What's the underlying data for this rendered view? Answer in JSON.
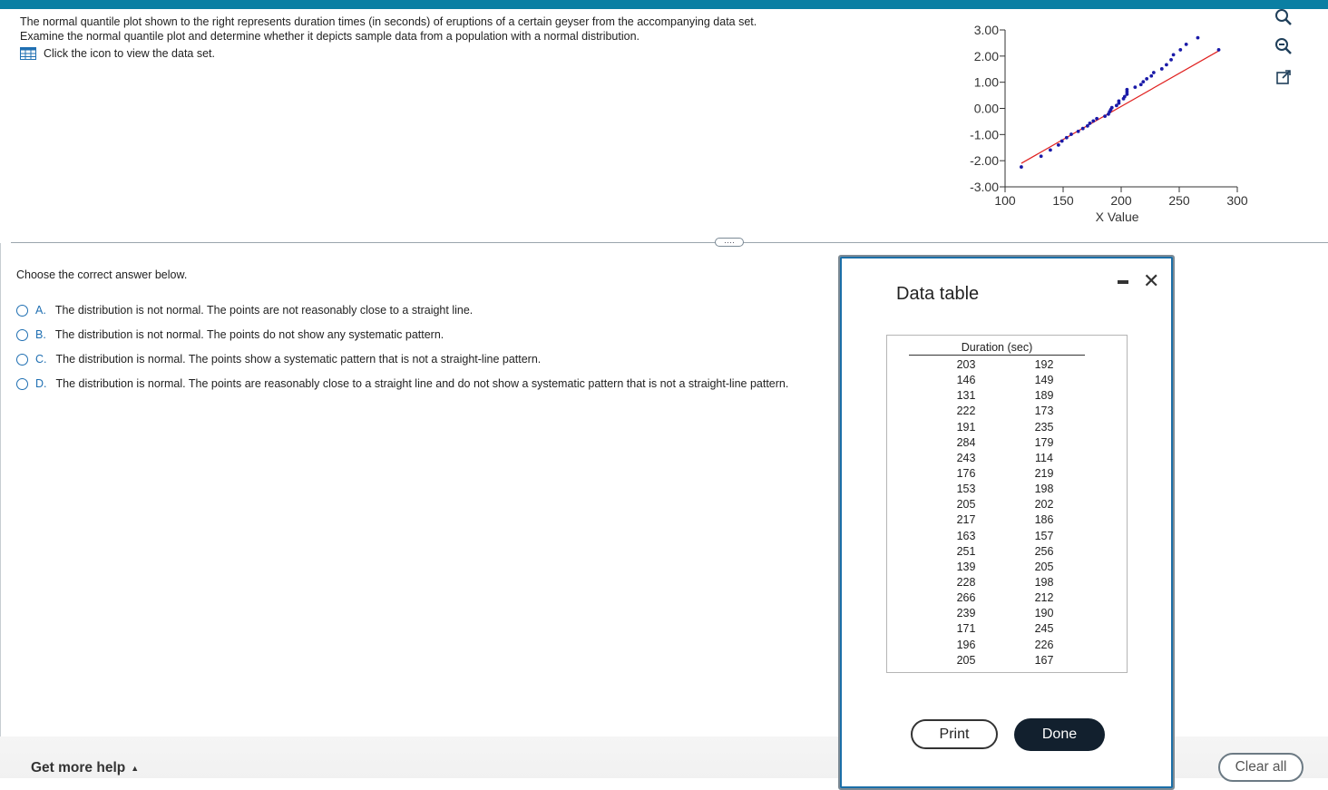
{
  "question": {
    "line1": "The normal quantile plot shown to the right represents duration times (in seconds) of eruptions of a certain geyser from the accompanying data set.",
    "line2": "Examine the normal quantile plot and determine whether it depicts sample data from a population with a normal distribution.",
    "dataset_link": "Click the icon to view the data set."
  },
  "prompt": "Choose the correct answer below.",
  "options": [
    {
      "letter": "A.",
      "text": "The distribution is not normal. The points are not reasonably close to a straight line."
    },
    {
      "letter": "B.",
      "text": "The distribution is not normal. The points do not show any systematic pattern."
    },
    {
      "letter": "C.",
      "text": "The distribution is normal. The points show a systematic pattern that is not a straight-line pattern."
    },
    {
      "letter": "D.",
      "text": "The distribution is normal. The points are reasonably close to a straight line and do not show a systematic pattern that is not a straight-line pattern."
    }
  ],
  "handle_label": "····",
  "footer": {
    "help": "Get more help",
    "help_arrow": "▲",
    "clear": "Clear all"
  },
  "dialog": {
    "title": "Data table",
    "column_header": "Duration (sec)",
    "col1": [
      "203",
      "146",
      "131",
      "222",
      "191",
      "284",
      "243",
      "176",
      "153",
      "205",
      "217",
      "163",
      "251",
      "139",
      "228",
      "266",
      "239",
      "171",
      "196",
      "205"
    ],
    "col2": [
      "192",
      "149",
      "189",
      "173",
      "235",
      "179",
      "114",
      "219",
      "198",
      "202",
      "186",
      "157",
      "256",
      "205",
      "198",
      "212",
      "190",
      "245",
      "226",
      "167"
    ],
    "print": "Print",
    "done": "Done",
    "close": "✕"
  },
  "chart_data": {
    "type": "scatter",
    "title": "",
    "xlabel": "X Value",
    "ylabel": "",
    "xlim": [
      100,
      300
    ],
    "ylim": [
      -3,
      3
    ],
    "xticks": [
      "100",
      "150",
      "200",
      "250",
      "300"
    ],
    "yticks": [
      "3.00",
      "2.00",
      "1.00",
      "0.00",
      "-1.00",
      "-2.00",
      "-3.00"
    ],
    "points": [
      [
        114,
        -2.24
      ],
      [
        131,
        -1.83
      ],
      [
        139,
        -1.59
      ],
      [
        146,
        -1.4
      ],
      [
        149,
        -1.25
      ],
      [
        153,
        -1.12
      ],
      [
        157,
        -0.99
      ],
      [
        163,
        -0.88
      ],
      [
        167,
        -0.77
      ],
      [
        171,
        -0.67
      ],
      [
        173,
        -0.57
      ],
      [
        176,
        -0.48
      ],
      [
        179,
        -0.39
      ],
      [
        186,
        -0.3
      ],
      [
        189,
        -0.22
      ],
      [
        190,
        -0.13
      ],
      [
        191,
        -0.05
      ],
      [
        192,
        0.03
      ],
      [
        196,
        0.11
      ],
      [
        198,
        0.2
      ],
      [
        198,
        0.28
      ],
      [
        202,
        0.37
      ],
      [
        203,
        0.45
      ],
      [
        205,
        0.54
      ],
      [
        205,
        0.63
      ],
      [
        205,
        0.72
      ],
      [
        212,
        0.81
      ],
      [
        217,
        0.91
      ],
      [
        219,
        1.02
      ],
      [
        222,
        1.13
      ],
      [
        226,
        1.24
      ],
      [
        228,
        1.37
      ],
      [
        235,
        1.51
      ],
      [
        239,
        1.67
      ],
      [
        243,
        1.86
      ],
      [
        245,
        2.05
      ],
      [
        251,
        2.24
      ],
      [
        256,
        2.45
      ],
      [
        266,
        2.7
      ],
      [
        284,
        2.24
      ]
    ],
    "fit_line": [
      [
        114,
        -2.1
      ],
      [
        284,
        2.2
      ]
    ],
    "point_color": "#1a1aa8",
    "line_color": "#e0201f"
  },
  "colors": {
    "accent": "#1f6fb2",
    "topbar": "#0a7fa3",
    "done_bg": "#12202e"
  },
  "icons": {
    "dataset": "table-icon",
    "zoom_in": "zoom-in-icon",
    "zoom_out": "zoom-out-icon",
    "popout": "popout-icon"
  }
}
